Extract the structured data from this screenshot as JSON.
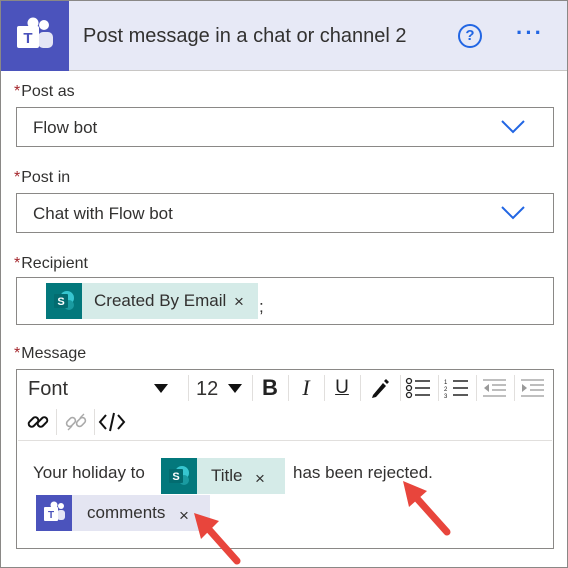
{
  "header": {
    "title": "Post message in a chat or channel 2",
    "help_icon": "question-circle-icon",
    "more_icon": "ellipsis-icon",
    "more_label": "···",
    "help_label": "?"
  },
  "fields": {
    "post_as": {
      "label": "Post as",
      "required": "*",
      "value": "Flow bot"
    },
    "post_in": {
      "label": "Post in",
      "required": "*",
      "value": "Chat with Flow bot"
    },
    "recipient": {
      "label": "Recipient",
      "required": "*",
      "token": "Created By Email",
      "token_close": "×",
      "separator": ";"
    },
    "message": {
      "label": "Message",
      "required": "*",
      "toolbar": {
        "font": "Font",
        "size": "12",
        "bold": "B",
        "italic": "I",
        "underline": "U"
      },
      "text_before": "Your holiday to",
      "title_token": "Title",
      "text_after": "has been rejected.",
      "comments_token": "comments",
      "token_close": "×"
    }
  },
  "colors": {
    "header_bg": "#e7e9f6",
    "teams_purple": "#4b53bc",
    "sharepoint_teal": "#03787c",
    "accent_blue": "#2266e3",
    "required_red": "#a4262c",
    "arrow_red": "#e8453c"
  }
}
